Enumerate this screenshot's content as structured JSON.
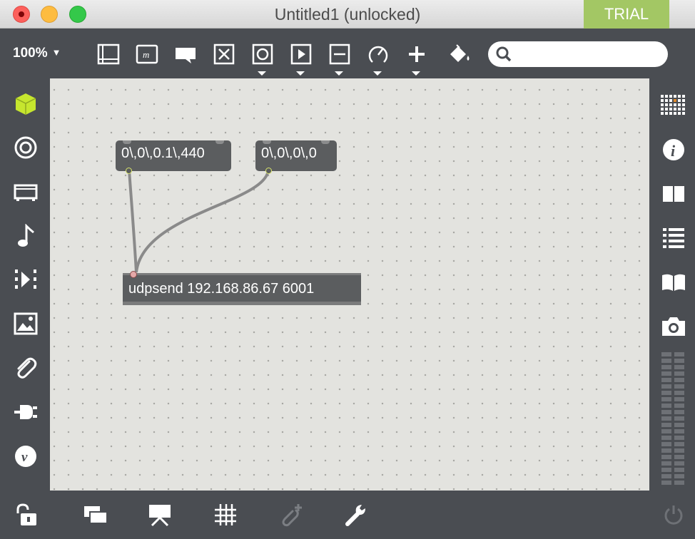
{
  "window": {
    "title": "Untitled1  (unlocked)",
    "trial_label": "TRIAL"
  },
  "toolbar": {
    "zoom": "100%",
    "zoom_caret": "▼",
    "search_placeholder": "",
    "icons": [
      "presentation-frame-icon",
      "comment-m-icon",
      "speech-bubble-icon",
      "toggle-x-icon",
      "button-circle-icon",
      "play-icon",
      "slider-icon",
      "dial-icon",
      "plus-icon",
      "paint-bucket-icon",
      "search-icon"
    ]
  },
  "left_sidebar": [
    "cube-icon",
    "target-icon",
    "device-icon",
    "music-note-icon",
    "step-sequence-icon",
    "image-icon",
    "paperclip-icon",
    "plug-icon",
    "vimeo-icon"
  ],
  "right_sidebar": [
    "grid-icon",
    "info-icon",
    "columns-icon",
    "list-icon",
    "book-icon",
    "camera-icon"
  ],
  "patch": {
    "message1": "0\\,0\\,0.1\\,440",
    "message2": "0\\,0\\,0\\,0",
    "object": "udpsend 192.168.86.67 6001"
  },
  "bottom_bar": [
    "lock-open-icon",
    "windows-icon",
    "presentation-icon",
    "grid-hash-icon",
    "paperclip-plus-icon",
    "wrench-icon",
    "power-icon"
  ],
  "colors": {
    "accent_green": "#c6e62e",
    "trial_bg": "#a3c764",
    "canvas_bg": "#e3e3df",
    "chrome_bg": "#4a4d52"
  }
}
